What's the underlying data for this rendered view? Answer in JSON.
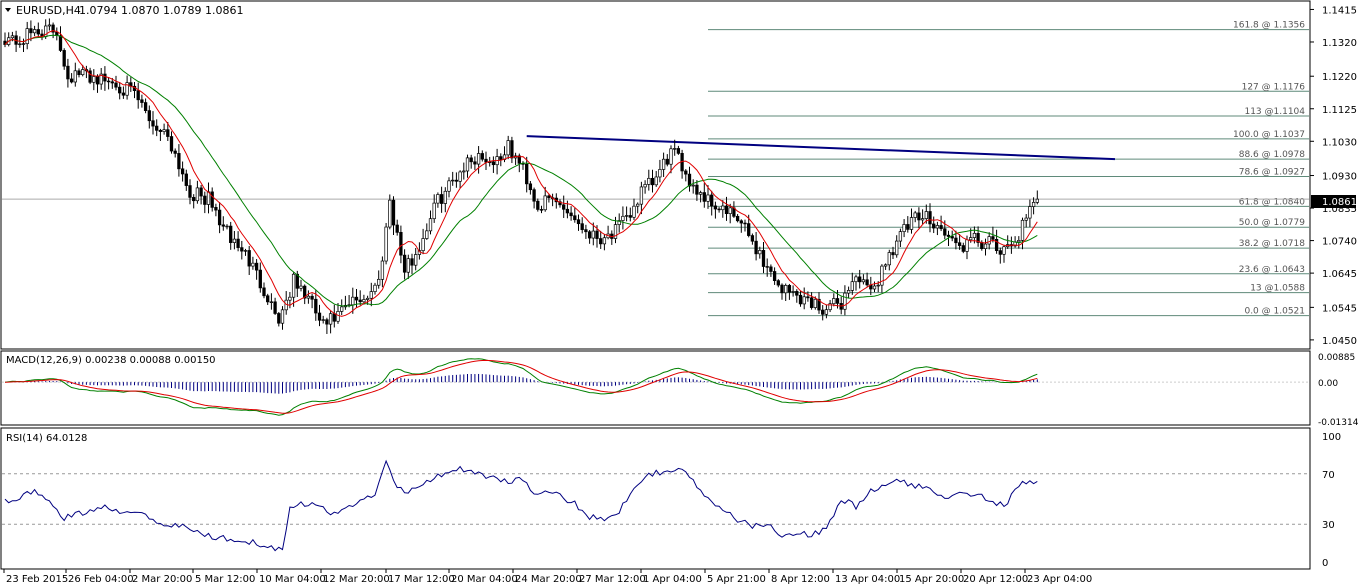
{
  "chart_data": [
    {
      "type": "candlestick",
      "title": "EURUSD,H4",
      "ohlc_text": "1.0794 1.0870 1.0789 1.0861",
      "last_price_label": "1.0861",
      "y_axis_ticks": [
        "1.1415",
        "1.1320",
        "1.1220",
        "1.1125",
        "1.1030",
        "1.0930",
        "1.0835",
        "1.0740",
        "1.0645",
        "1.0545",
        "1.0450"
      ],
      "ylim": [
        1.0438,
        1.1428
      ],
      "x_axis_ticks": [
        "23 Feb 2015",
        "26 Feb 04:00",
        "2 Mar 20:00",
        "5 Mar 12:00",
        "10 Mar 04:00",
        "12 Mar 20:00",
        "17 Mar 12:00",
        "20 Mar 04:00",
        "24 Mar 20:00",
        "27 Mar 12:00",
        "1 Apr 04:00",
        "5 Apr 21:00",
        "8 Apr 12:00",
        "13 Apr 04:00",
        "15 Apr 20:00",
        "20 Apr 12:00",
        "23 Apr 04:00"
      ],
      "price_path": [
        [
          0,
          1.1335
        ],
        [
          4,
          1.132
        ],
        [
          8,
          1.1355
        ],
        [
          14,
          1.135
        ],
        [
          17,
          1.122
        ],
        [
          22,
          1.1225
        ],
        [
          26,
          1.121
        ],
        [
          30,
          1.12
        ],
        [
          35,
          1.1165
        ],
        [
          40,
          1.108
        ],
        [
          44,
          1.105
        ],
        [
          50,
          1.088
        ],
        [
          55,
          1.086
        ],
        [
          60,
          1.076
        ],
        [
          65,
          1.07
        ],
        [
          70,
          1.06
        ],
        [
          74,
          1.051
        ],
        [
          78,
          1.062
        ],
        [
          82,
          1.057
        ],
        [
          86,
          1.049
        ],
        [
          90,
          1.052
        ],
        [
          94,
          1.056
        ],
        [
          98,
          1.058
        ],
        [
          101,
          1.062
        ],
        [
          104,
          1.086
        ],
        [
          108,
          1.065
        ],
        [
          112,
          1.072
        ],
        [
          116,
          1.084
        ],
        [
          120,
          1.09
        ],
        [
          124,
          1.096
        ],
        [
          128,
          1.099
        ],
        [
          132,
          1.097
        ],
        [
          136,
          1.101
        ],
        [
          140,
          1.095
        ],
        [
          144,
          1.084
        ],
        [
          148,
          1.086
        ],
        [
          152,
          1.083
        ],
        [
          156,
          1.078
        ],
        [
          160,
          1.075
        ],
        [
          164,
          1.076
        ],
        [
          168,
          1.08
        ],
        [
          172,
          1.088
        ],
        [
          176,
          1.092
        ],
        [
          180,
          1.1
        ],
        [
          183,
          1.096
        ],
        [
          186,
          1.09
        ],
        [
          190,
          1.086
        ],
        [
          194,
          1.083
        ],
        [
          198,
          1.08
        ],
        [
          202,
          1.074
        ],
        [
          206,
          1.066
        ],
        [
          210,
          1.06
        ],
        [
          214,
          1.058
        ],
        [
          218,
          1.056
        ],
        [
          222,
          1.054
        ],
        [
          226,
          1.056
        ],
        [
          230,
          1.064
        ],
        [
          234,
          1.058
        ],
        [
          238,
          1.068
        ],
        [
          242,
          1.076
        ],
        [
          246,
          1.08
        ],
        [
          250,
          1.081
        ],
        [
          254,
          1.076
        ],
        [
          258,
          1.072
        ],
        [
          262,
          1.074
        ],
        [
          266,
          1.073
        ],
        [
          270,
          1.07
        ],
        [
          274,
          1.076
        ],
        [
          276,
          1.08
        ],
        [
          279,
          1.0861
        ]
      ],
      "moving_averages": [
        {
          "color": "#e00000"
        },
        {
          "color": "#008000"
        }
      ],
      "trendline": {
        "color": "#000080",
        "from": [
          141,
          1.1045
        ],
        "to": [
          300,
          1.0978
        ]
      },
      "fibonacci": {
        "color": "#5f8a7a",
        "start_index": 190,
        "levels": [
          {
            "label": "161.8 @ 1.1356",
            "price": 1.1356
          },
          {
            "label": "127 @ 1.1176",
            "price": 1.1176
          },
          {
            "label": "113 @1.1104",
            "price": 1.1104
          },
          {
            "label": "100.0 @ 1.1037",
            "price": 1.1037
          },
          {
            "label": "88.6 @ 1.0978",
            "price": 1.0978
          },
          {
            "label": "78.6 @ 1.0927",
            "price": 1.0927
          },
          {
            "label": "61.8 @ 1.0840",
            "price": 1.084
          },
          {
            "label": "50.0 @ 1.0779",
            "price": 1.0779
          },
          {
            "label": "38.2 @ 1.0718",
            "price": 1.0718
          },
          {
            "label": "23.6 @ 1.0643",
            "price": 1.0643
          },
          {
            "label": "13 @1.0588",
            "price": 1.0588
          },
          {
            "label": "0.0 @ 1.0521",
            "price": 1.0521
          }
        ]
      }
    },
    {
      "type": "macd",
      "title": "MACD(12,26,9) 0.00238 0.00088 0.00150",
      "y_axis_ticks": [
        "0.00885",
        "0.00",
        "-0.01314"
      ],
      "ylim": [
        -0.01314,
        0.00885
      ],
      "macd_line_color": "#008000",
      "signal_line_color": "#e00000",
      "histogram_color": "#000080"
    },
    {
      "type": "line",
      "title": "RSI(14) 64.0128",
      "y_axis_ticks": [
        "100",
        "70",
        "30",
        "0"
      ],
      "ylim": [
        0,
        100
      ],
      "levels": [
        70,
        30
      ],
      "line_color": "#000080",
      "rsi_path": [
        [
          0,
          48
        ],
        [
          4,
          52
        ],
        [
          8,
          55
        ],
        [
          12,
          50
        ],
        [
          16,
          35
        ],
        [
          20,
          38
        ],
        [
          24,
          42
        ],
        [
          28,
          44
        ],
        [
          32,
          40
        ],
        [
          36,
          41
        ],
        [
          40,
          34
        ],
        [
          44,
          30
        ],
        [
          48,
          28
        ],
        [
          52,
          24
        ],
        [
          56,
          20
        ],
        [
          60,
          19
        ],
        [
          64,
          18
        ],
        [
          68,
          15
        ],
        [
          72,
          12
        ],
        [
          75,
          10
        ],
        [
          77,
          45
        ],
        [
          80,
          47
        ],
        [
          84,
          45
        ],
        [
          88,
          38
        ],
        [
          92,
          43
        ],
        [
          96,
          48
        ],
        [
          100,
          55
        ],
        [
          103,
          78
        ],
        [
          106,
          60
        ],
        [
          109,
          56
        ],
        [
          112,
          60
        ],
        [
          116,
          68
        ],
        [
          120,
          72
        ],
        [
          124,
          74
        ],
        [
          128,
          70
        ],
        [
          132,
          66
        ],
        [
          136,
          64
        ],
        [
          140,
          67
        ],
        [
          143,
          52
        ],
        [
          146,
          56
        ],
        [
          150,
          52
        ],
        [
          154,
          46
        ],
        [
          158,
          36
        ],
        [
          162,
          35
        ],
        [
          166,
          40
        ],
        [
          170,
          60
        ],
        [
          174,
          70
        ],
        [
          178,
          72
        ],
        [
          182,
          75
        ],
        [
          186,
          64
        ],
        [
          190,
          50
        ],
        [
          194,
          40
        ],
        [
          198,
          34
        ],
        [
          202,
          28
        ],
        [
          206,
          30
        ],
        [
          210,
          22
        ],
        [
          214,
          24
        ],
        [
          218,
          21
        ],
        [
          222,
          27
        ],
        [
          226,
          50
        ],
        [
          230,
          44
        ],
        [
          234,
          56
        ],
        [
          238,
          62
        ],
        [
          242,
          64
        ],
        [
          246,
          60
        ],
        [
          250,
          58
        ],
        [
          254,
          52
        ],
        [
          258,
          56
        ],
        [
          262,
          54
        ],
        [
          266,
          50
        ],
        [
          270,
          44
        ],
        [
          274,
          60
        ],
        [
          277,
          65
        ],
        [
          279,
          64
        ]
      ]
    }
  ]
}
